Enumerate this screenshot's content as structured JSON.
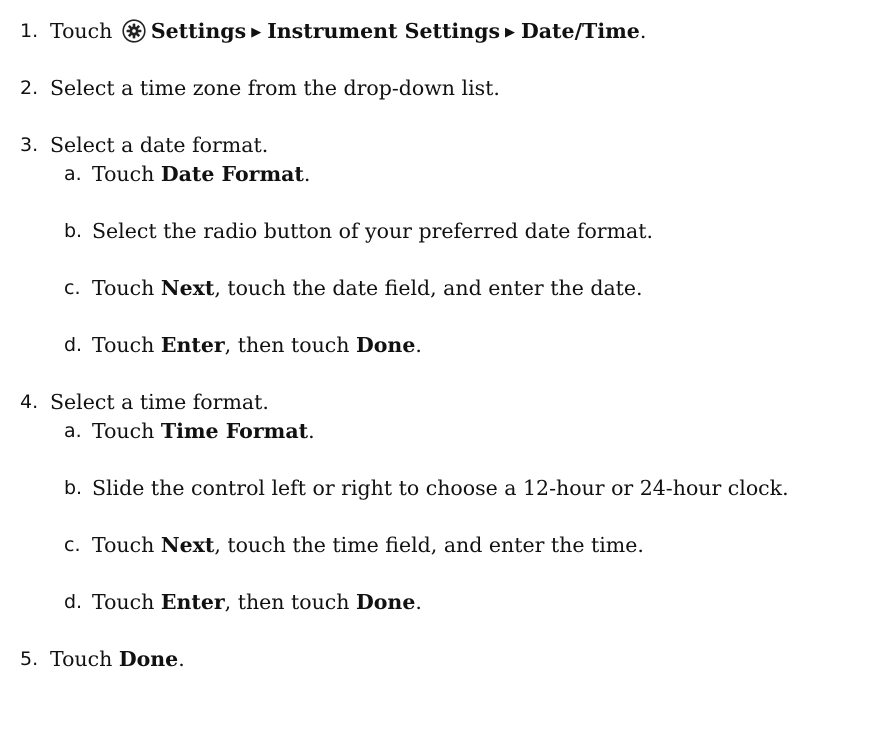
{
  "steps": [
    {
      "num": "1.",
      "parts": {
        "pre": "Touch",
        "icon": "gear-icon",
        "settings": "Settings",
        "sep_icon": "right-triangle-arrow-icon",
        "instrument": "Instrument Settings",
        "datetime": "Date/Time",
        "end": "."
      }
    },
    {
      "num": "2.",
      "text": "Select a time zone from the drop-down list."
    },
    {
      "num": "3.",
      "text": "Select a date format.",
      "substeps": [
        {
          "num": "a.",
          "pre": "Touch ",
          "bold": "Date Format",
          "post": "."
        },
        {
          "num": "b.",
          "text": "Select the radio button of your preferred date format."
        },
        {
          "num": "c.",
          "pre": "Touch ",
          "bold": "Next",
          "post": ", touch the date field, and enter the date."
        },
        {
          "num": "d.",
          "pre": "Touch ",
          "bold": "Enter",
          "mid": ", then touch ",
          "bold2": "Done",
          "post": "."
        }
      ]
    },
    {
      "num": "4.",
      "text": "Select a time format.",
      "substeps": [
        {
          "num": "a.",
          "pre": "Touch ",
          "bold": "Time Format",
          "post": "."
        },
        {
          "num": "b.",
          "text": "Slide the control left or right to choose a 12-hour or 24-hour clock."
        },
        {
          "num": "c.",
          "pre": "Touch ",
          "bold": "Next",
          "post": ", touch the time field, and enter the time."
        },
        {
          "num": "d.",
          "pre": "Touch ",
          "bold": "Enter",
          "mid": ", then touch ",
          "bold2": "Done",
          "post": "."
        }
      ]
    },
    {
      "num": "5.",
      "pre": "Touch ",
      "bold": "Done",
      "post": "."
    }
  ]
}
